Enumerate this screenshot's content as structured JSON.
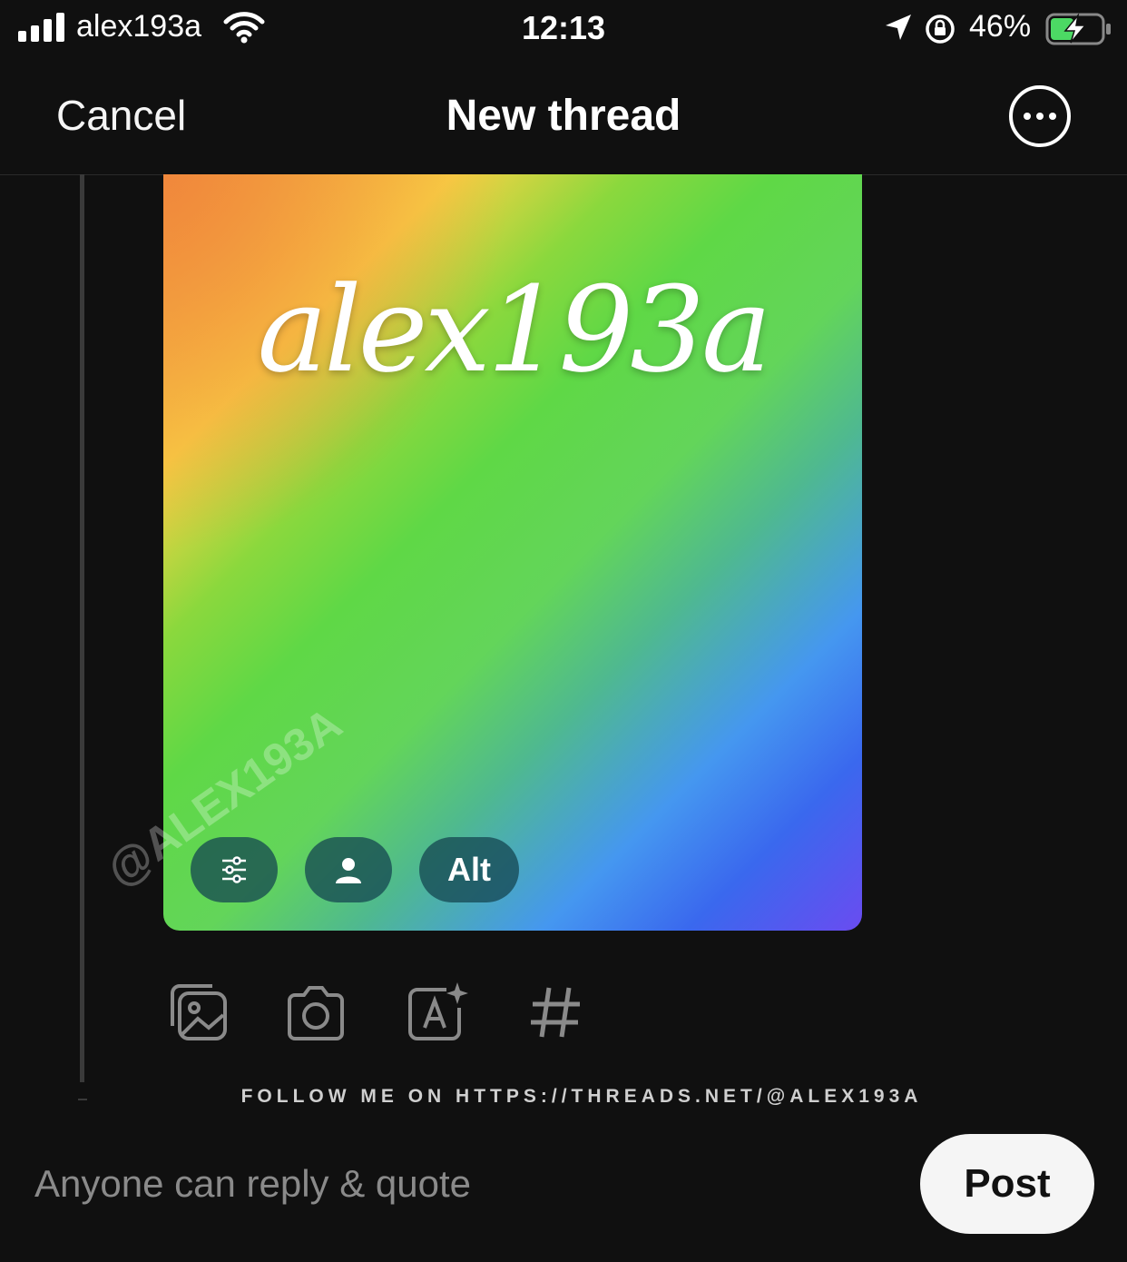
{
  "status_bar": {
    "carrier": "alex193a",
    "time": "12:13",
    "battery_percent": "46%",
    "battery_level": 0.46,
    "battery_color": "#4cd964",
    "icons": [
      "signal-icon",
      "wifi-icon",
      "location-icon",
      "orientation-lock-icon",
      "battery-charging-icon"
    ]
  },
  "header": {
    "cancel_label": "Cancel",
    "title": "New thread",
    "more_icon": "more-options-icon"
  },
  "media": {
    "handle_text": "alex193a",
    "alt_label": "Alt",
    "edit_icon": "sliders-icon",
    "tag_icon": "person-icon"
  },
  "watermark": "@ALEX193A",
  "toolbar": {
    "icons": [
      "gallery-icon",
      "camera-icon",
      "ai-text-icon",
      "hashtag-icon"
    ]
  },
  "footer": {
    "follow_text": "FOLLOW ME ON HTTPS://THREADS.NET/@ALEX193A",
    "reply_setting": "Anyone can reply & quote",
    "post_label": "Post"
  },
  "colors": {
    "background": "#101010",
    "post_button_bg": "#f5f5f5",
    "muted_text": "#8a8a8a"
  }
}
